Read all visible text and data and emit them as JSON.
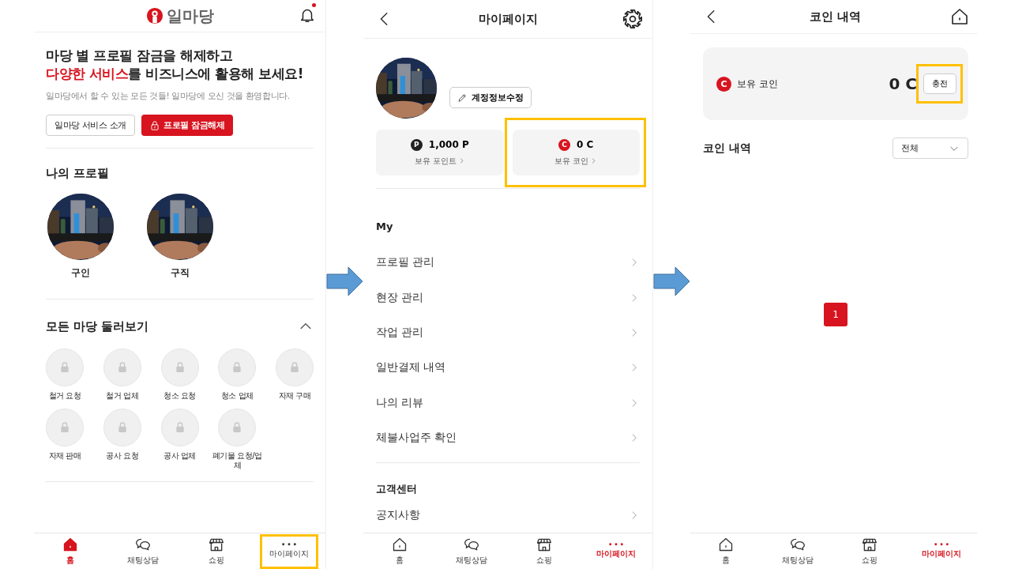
{
  "home_screen": {
    "logo": {
      "text": "일마당"
    },
    "notifications": {
      "unread": true
    },
    "headline": {
      "line_1": "마당 별 프로필 잠금을 해제하고",
      "line_2_accent": "다양한 서비스",
      "line_2_rest": "를 비즈니스에 활용해 보세요!"
    },
    "subtitle": "일마당에서 할 수 있는 모든 것들! 일마당에 오신 것을 환영합니다.",
    "buttons": [
      {
        "label": "일마당 서비스 소개",
        "kind": "outline"
      },
      {
        "label": "프로필 잠금해제",
        "kind": "primary"
      }
    ],
    "my_profile": {
      "title": "나의 프로필",
      "profiles": [
        {
          "label": "구인",
          "kind": "picture"
        },
        {
          "label": "구직",
          "kind": "picture"
        }
      ]
    },
    "all_madang": {
      "title": "모든 마당 둘러보기",
      "expanded": true,
      "items": [
        {
          "label": "철거 요청",
          "locked": true
        },
        {
          "label": "철거 업체",
          "locked": true
        },
        {
          "label": "청소 요청",
          "locked": true
        },
        {
          "label": "청소 업체",
          "locked": true
        },
        {
          "label": "자재 구매",
          "locked": true
        },
        {
          "label": "자재 판매",
          "locked": true
        },
        {
          "label": "공사 요청",
          "locked": true
        },
        {
          "label": "공사 업체",
          "locked": true
        },
        {
          "label": "폐기물 요청/업체",
          "locked": true
        }
      ]
    },
    "nav": [
      {
        "label": "홈",
        "kind": "home",
        "selected": true,
        "highlighted": false
      },
      {
        "label": "채팅상담",
        "kind": "chat",
        "selected": false,
        "highlighted": false
      },
      {
        "label": "쇼핑",
        "kind": "shop",
        "selected": false,
        "highlighted": false
      },
      {
        "label": "마이페이지",
        "kind": "more",
        "selected": false,
        "highlighted": true
      }
    ]
  },
  "mypage_screen": {
    "title": "마이페이지",
    "edit_button": "계정정보수정",
    "wallet": [
      {
        "badge": "P",
        "kind": "point",
        "amount": "1,000 P",
        "label": "보유 포인트",
        "highlighted": false
      },
      {
        "badge": "C",
        "kind": "coin",
        "amount": "0 C",
        "label": "보유 코인",
        "highlighted": true
      }
    ],
    "sections": [
      {
        "title": "My",
        "items": [
          "프로필 관리",
          "현장 관리",
          "작업 관리",
          "일반결제 내역",
          "나의 리뷰",
          "체불사업주 확인"
        ]
      },
      {
        "title": "고객센터",
        "items": [
          "공지사항"
        ]
      }
    ],
    "nav": [
      {
        "label": "홈",
        "kind": "home",
        "selected": false,
        "highlighted": false
      },
      {
        "label": "채팅상담",
        "kind": "chat",
        "selected": false,
        "highlighted": false
      },
      {
        "label": "쇼핑",
        "kind": "shop",
        "selected": false,
        "highlighted": false
      },
      {
        "label": "마이페이지",
        "kind": "more",
        "selected": true,
        "highlighted": false
      }
    ]
  },
  "coin_screen": {
    "title": "코인 내역",
    "balance": {
      "badge": "C",
      "label": "보유 코인",
      "amount": "0 C",
      "charge_button": "충전",
      "highlighted": true
    },
    "history": {
      "title": "코인 내역",
      "filter": "전체"
    },
    "pagination": [
      {
        "label": "1",
        "selected": true
      }
    ],
    "nav": [
      {
        "label": "홈",
        "kind": "home",
        "selected": false,
        "highlighted": false
      },
      {
        "label": "채팅상담",
        "kind": "chat",
        "selected": false,
        "highlighted": false
      },
      {
        "label": "쇼핑",
        "kind": "shop",
        "selected": false,
        "highlighted": false
      },
      {
        "label": "마이페이지",
        "kind": "more",
        "selected": true,
        "highlighted": false
      }
    ]
  }
}
